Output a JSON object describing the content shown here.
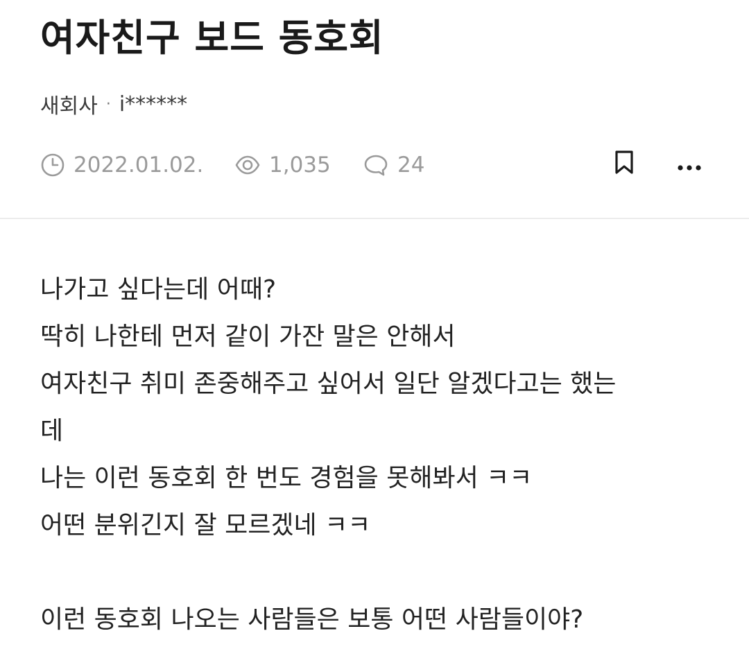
{
  "post": {
    "title": "여자친구 보드 동호회",
    "board": "새회사",
    "author": "i******",
    "separator": "·",
    "date": "2022.01.02.",
    "views": "1,035",
    "comments": "24"
  },
  "icons": {
    "time": "clock-icon",
    "views": "eye-icon",
    "comments": "speech-bubble-icon",
    "bookmark": "bookmark-icon",
    "more": "more-dots-icon"
  },
  "colors": {
    "title": "#1a1a1a",
    "meta": "#9a9a9a",
    "body": "#222222",
    "divider": "#ececec"
  },
  "content": {
    "lines": [
      "나가고 싶다는데 어때?",
      "딱히 나한테 먼저 같이 가잔 말은 안해서",
      "여자친구 취미 존중해주고 싶어서 일단 알겠다고는 했는",
      "데",
      "나는 이런 동호회 한 번도 경험을 못해봐서 ㅋㅋ",
      "어떤 분위긴지 잘 모르겠네 ㅋㅋ",
      "",
      "이런 동호회 나오는 사람들은 보통 어떤 사람들이야?"
    ]
  }
}
